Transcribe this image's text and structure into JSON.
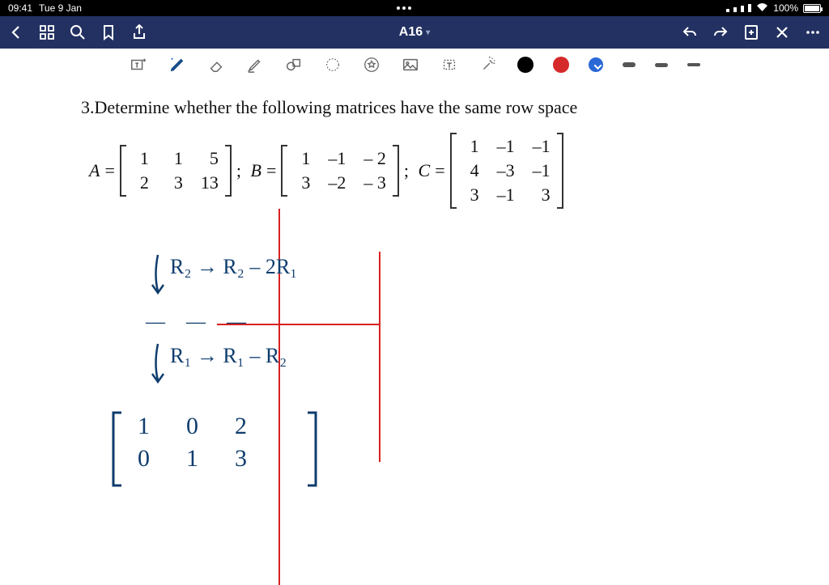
{
  "status": {
    "time": "09:41",
    "date": "Tue 9 Jan",
    "battery": "100%"
  },
  "nav": {
    "title": "A16"
  },
  "colors": {
    "accent": "#233162",
    "hand": "#0f3d6e",
    "red": "#d92020",
    "pen_red": "#d62a2a",
    "pen_blue": "#2a68d6"
  },
  "problem": {
    "number": "3.",
    "text": "Determine whether the following matrices have the same row space"
  },
  "matrices": {
    "A": {
      "label": "A",
      "rows": [
        [
          "1",
          "1",
          "5"
        ],
        [
          "2",
          "3",
          "13"
        ]
      ]
    },
    "B": {
      "label": "B",
      "rows": [
        [
          "1",
          "–1",
          "– 2"
        ],
        [
          "3",
          "–2",
          "– 3"
        ]
      ]
    },
    "C": {
      "label": "C",
      "rows": [
        [
          "1",
          "–1",
          "–1"
        ],
        [
          "4",
          "–3",
          "–1"
        ],
        [
          "3",
          "–1",
          "3"
        ]
      ]
    }
  },
  "handwriting": {
    "step1": "R₂ → R₂ – 2R₁",
    "dashes": "—  — —",
    "step2": "R₁ → R₁ – R₂",
    "result": {
      "rows": [
        [
          "1",
          "0",
          "2"
        ],
        [
          "0",
          "1",
          "3"
        ]
      ]
    }
  }
}
